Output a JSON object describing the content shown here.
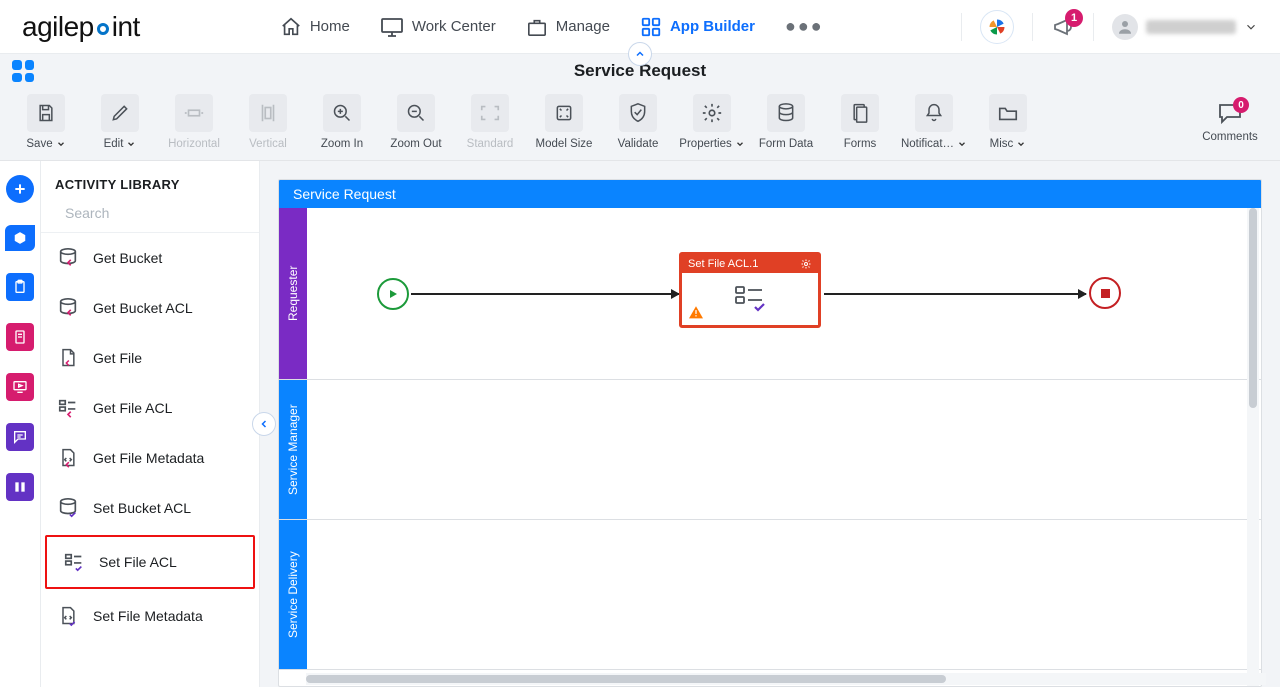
{
  "brand": {
    "name_left": "agilep",
    "name_right": "int"
  },
  "nav": {
    "items": [
      {
        "label": "Home"
      },
      {
        "label": "Work Center"
      },
      {
        "label": "Manage"
      },
      {
        "label": "App Builder"
      }
    ],
    "notification_count": "1"
  },
  "page_title": "Service Request",
  "ribbon": {
    "save": "Save",
    "edit": "Edit",
    "horizontal": "Horizontal",
    "vertical": "Vertical",
    "zoom_in": "Zoom In",
    "zoom_out": "Zoom Out",
    "standard": "Standard",
    "model_size": "Model Size",
    "validate": "Validate",
    "properties": "Properties",
    "form_data": "Form Data",
    "forms": "Forms",
    "notifications": "Notificat…",
    "misc": "Misc",
    "comments": "Comments",
    "comments_count": "0"
  },
  "activity_library": {
    "title": "ACTIVITY LIBRARY",
    "search_placeholder": "Search",
    "items": [
      {
        "label": "Get Bucket"
      },
      {
        "label": "Get Bucket ACL"
      },
      {
        "label": "Get File"
      },
      {
        "label": "Get File ACL"
      },
      {
        "label": "Get File Metadata"
      },
      {
        "label": "Set Bucket ACL"
      },
      {
        "label": "Set File ACL",
        "highlight": true
      },
      {
        "label": "Set File Metadata"
      }
    ]
  },
  "canvas": {
    "title": "Service Request",
    "lanes": [
      {
        "label": "Requester"
      },
      {
        "label": "Service Manager"
      },
      {
        "label": "Service Delivery"
      }
    ],
    "node": {
      "title": "Set File ACL.1"
    }
  }
}
